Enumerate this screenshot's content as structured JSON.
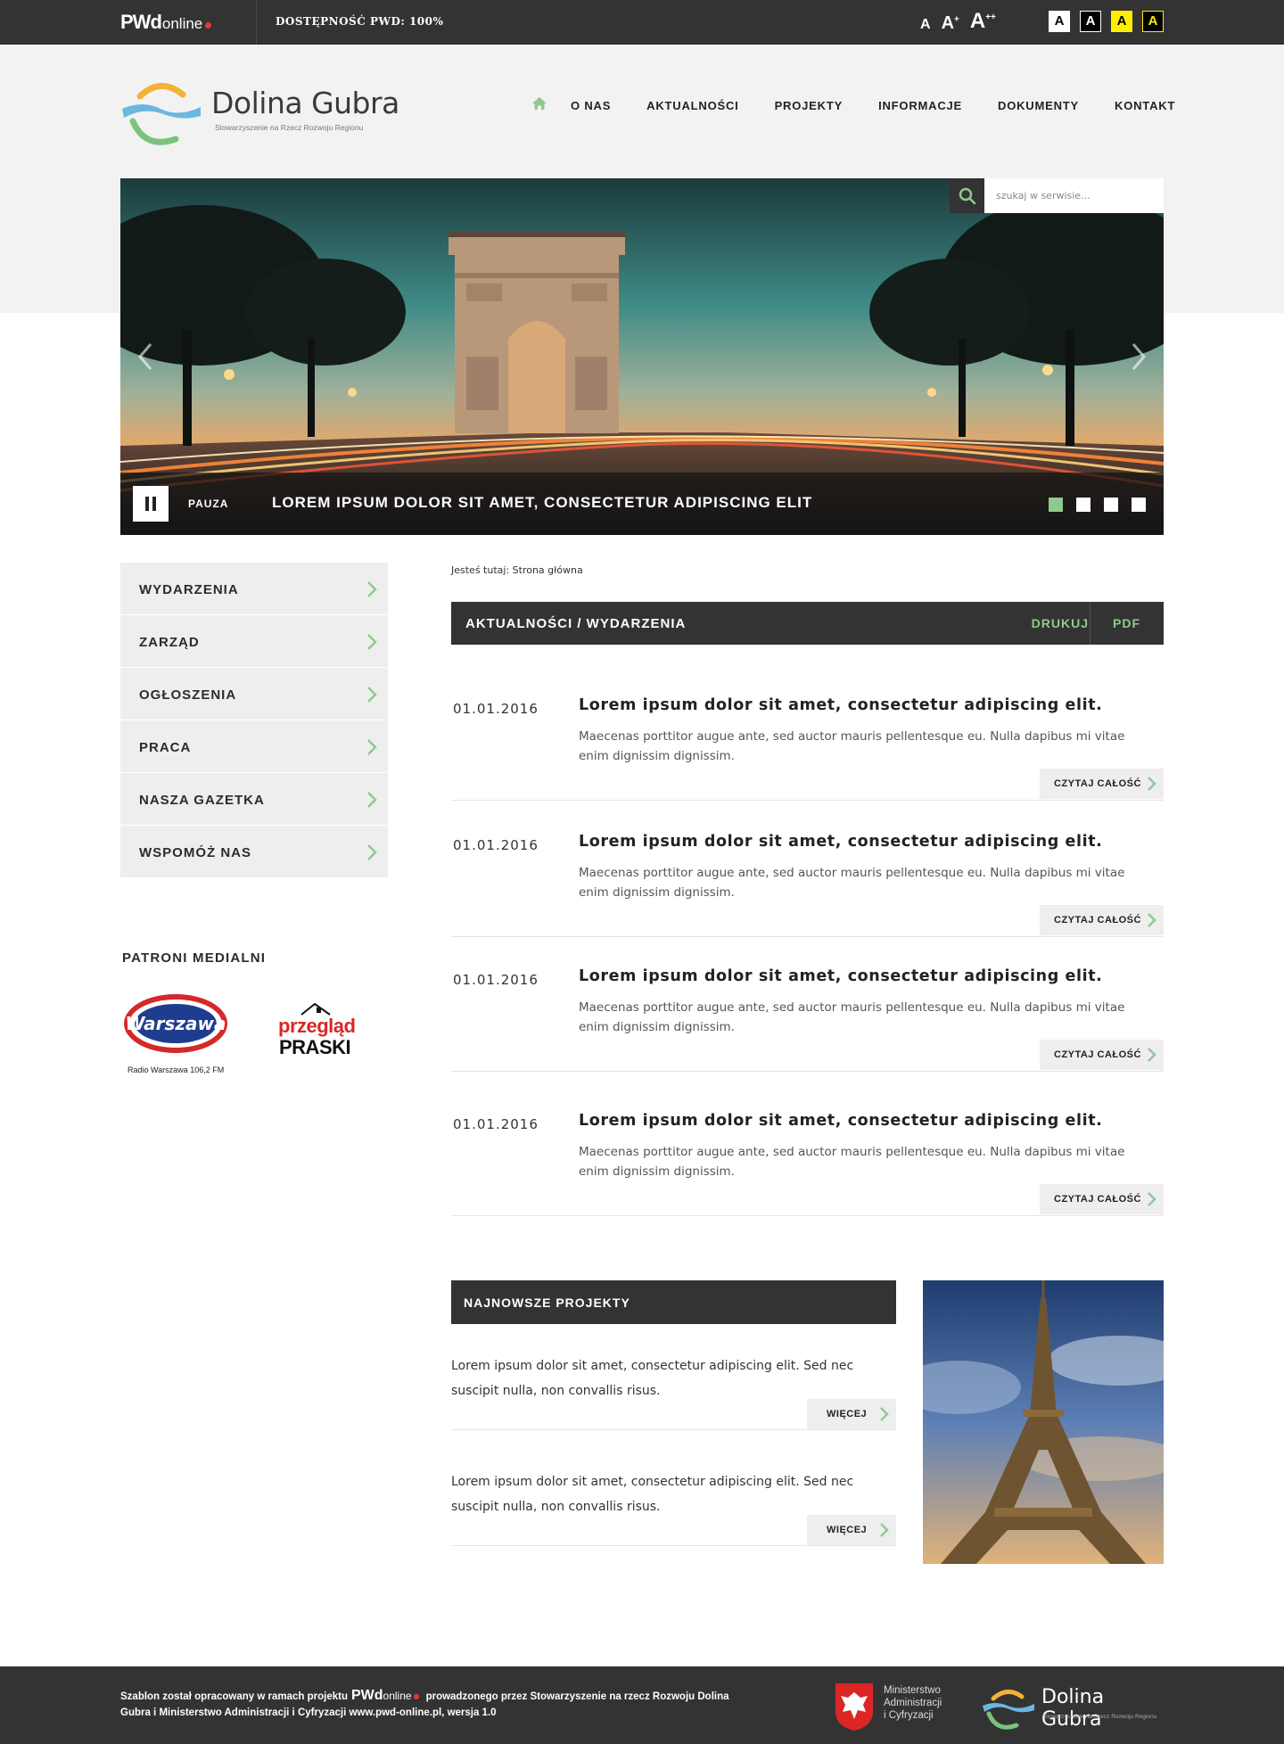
{
  "topbar": {
    "logo_main": "PWd",
    "logo_suffix": "online",
    "accessibility": "DOSTĘPNOŚĆ PWD: 100%",
    "font_sizes": [
      "A",
      "A",
      "A"
    ],
    "font_size_marks": [
      "",
      "+",
      "++"
    ],
    "contrast_options": [
      "A",
      "A",
      "A",
      "A"
    ]
  },
  "header": {
    "logo_title": "Dolina Gubra",
    "logo_subtitle": "Stowarzyszenie na Rzecz Rozwoju Regionu",
    "nav": [
      "O NAS",
      "AKTUALNOŚCI",
      "PROJEKTY",
      "INFORMACJE",
      "DOKUMENTY",
      "KONTAKT"
    ]
  },
  "search": {
    "placeholder": "szukaj w serwisie..."
  },
  "slider": {
    "pause_label": "PAUZA",
    "caption": "LOREM IPSUM DOLOR SIT AMET, CONSECTETUR ADIPISCING ELIT",
    "slides_count": 4,
    "active_slide": 1
  },
  "sidebar": {
    "menu": [
      "WYDARZENIA",
      "ZARZĄD",
      "OGŁOSZENIA",
      "PRACA",
      "NASZA GAZETKA",
      "WSPOMÓŻ NAS"
    ],
    "patrons_title": "PATRONI MEDIALNI",
    "patron1_logo_text": "Warszawa",
    "patron1_caption": "Radio Warszawa 106,2 FM",
    "patron2_line1": "przegląd",
    "patron2_line2": "PRASKI"
  },
  "main": {
    "breadcrumb": "Jesteś tutaj: Strona główna",
    "section_title": "AKTUALNOŚCI / WYDARZENIA",
    "print_label": "DRUKUJ",
    "pdf_label": "PDF",
    "news": [
      {
        "date": "01.01.2016",
        "title": "Lorem ipsum dolor sit amet, consectetur adipiscing elit.",
        "excerpt": "Maecenas porttitor augue ante, sed auctor mauris pellentesque eu. Nulla dapibus mi vitae enim dignissim dignissim.",
        "more": "CZYTAJ CAŁOŚĆ"
      },
      {
        "date": "01.01.2016",
        "title": "Lorem ipsum dolor sit amet, consectetur adipiscing elit.",
        "excerpt": "Maecenas porttitor augue ante, sed auctor mauris pellentesque eu. Nulla dapibus mi vitae enim dignissim dignissim.",
        "more": "CZYTAJ CAŁOŚĆ"
      },
      {
        "date": "01.01.2016",
        "title": "Lorem ipsum dolor sit amet, consectetur adipiscing elit.",
        "excerpt": "Maecenas porttitor augue ante, sed auctor mauris pellentesque eu. Nulla dapibus mi vitae enim dignissim dignissim.",
        "more": "CZYTAJ CAŁOŚĆ"
      },
      {
        "date": "01.01.2016",
        "title": "Lorem ipsum dolor sit amet, consectetur adipiscing elit.",
        "excerpt": "Maecenas porttitor augue ante, sed auctor mauris pellentesque eu. Nulla dapibus mi vitae enim dignissim dignissim.",
        "more": "CZYTAJ CAŁOŚĆ"
      }
    ],
    "projects_title": "NAJNOWSZE PROJEKTY",
    "projects": [
      {
        "text": "Lorem ipsum dolor sit amet, consectetur adipiscing elit. Sed nec suscipit nulla, non convallis risus.",
        "more": "WIĘCEJ"
      },
      {
        "text": "Lorem ipsum dolor sit amet, consectetur adipiscing elit. Sed nec suscipit nulla, non convallis risus.",
        "more": "WIĘCEJ"
      }
    ]
  },
  "footer": {
    "text_before": "Szablon został opracowany w ramach projektu",
    "pwd_main": "PWd",
    "pwd_suffix": "online",
    "text_after": "prowadzonego przez Stowarzyszenie na rzecz Rozwoju Dolina Gubra i Ministerstwo Administracji i Cyfryzacji www.pwd-online.pl, wersja 1.0",
    "ministry_line1": "Ministerstwo",
    "ministry_line2": "Administracji",
    "ministry_line3": "i Cyfryzacji",
    "logo_title": "Dolina Gubra",
    "logo_subtitle": "Stowarzyszenie na Rzecz Rozwoju Regionu"
  },
  "colors": {
    "dark": "#333333",
    "accent_green": "#8fc98f",
    "light_bg": "#f2f2f2",
    "menu_bg": "#eeeeee"
  },
  "icons": [
    "home-icon",
    "search-icon",
    "chevron-left-icon",
    "chevron-right-icon",
    "pause-icon",
    "chevron-right-icon"
  ]
}
